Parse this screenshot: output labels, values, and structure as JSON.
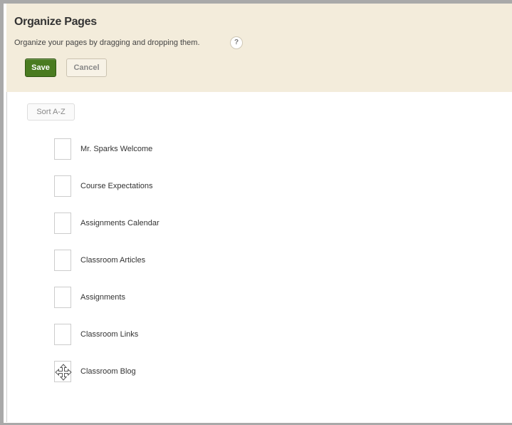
{
  "header": {
    "title": "Organize Pages",
    "subtitle": "Organize your pages by dragging and dropping them.",
    "help_icon": "?",
    "save_label": "Save",
    "cancel_label": "Cancel"
  },
  "toolbar": {
    "sort_label": "Sort A-Z"
  },
  "pages": [
    {
      "label": "Mr. Sparks Welcome",
      "handle_icon": "empty-box"
    },
    {
      "label": "Course Expectations",
      "handle_icon": "empty-box"
    },
    {
      "label": "Assignments Calendar",
      "handle_icon": "empty-box"
    },
    {
      "label": "Classroom Articles",
      "handle_icon": "empty-box"
    },
    {
      "label": "Assignments",
      "handle_icon": "empty-box"
    },
    {
      "label": "Classroom Links",
      "handle_icon": "empty-box"
    },
    {
      "label": "Classroom Blog",
      "handle_icon": "move-icon"
    }
  ],
  "colors": {
    "header_bg": "#f3ecdb",
    "save_bg": "#4a7b20",
    "frame_border": "#a9a9a9"
  }
}
